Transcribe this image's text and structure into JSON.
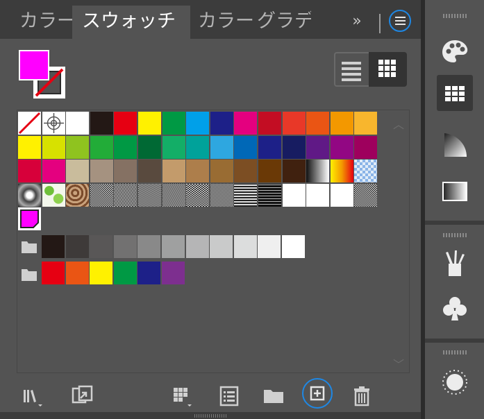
{
  "tabs": [
    {
      "label": "カラー"
    },
    {
      "label": "スウォッチ"
    },
    {
      "label": "カラー"
    },
    {
      "label": "グラデ"
    }
  ],
  "tab_overflow": "»",
  "colors": {
    "accent_ring": "#1e88e5",
    "fill_color": "#ff00ff",
    "panel_bg": "#535353",
    "tabbar_bg": "#3c3c3c"
  },
  "swatch_rows": {
    "row1": [
      "none",
      "registration",
      "#ffffff",
      "#231815",
      "#e60012",
      "#fff100",
      "#009944",
      "#00a0e9",
      "#1d2088",
      "#e4007f",
      "#c30d23",
      "#e83828",
      "#ea5514",
      "#f39800",
      "#f8b62d"
    ],
    "row2": [
      "#fff100",
      "#d7e100",
      "#8fc31f",
      "#22ac38",
      "#009944",
      "#006934",
      "#13ae67",
      "#00a29a",
      "#2ea7e0",
      "#0068b7",
      "#1d2088",
      "#171c61",
      "#601986",
      "#920783",
      "#9e005d"
    ],
    "row3": [
      "#d7003a",
      "#e4007f",
      "#c9bc9c",
      "#a59280",
      "#857163",
      "#594a3e",
      "#c39b6b",
      "#ad7e4b",
      "#996c33",
      "#7c4e23",
      "#6a3906",
      "#40210f",
      "gradient-bw",
      "gradient-ygr",
      "gradient-blue"
    ],
    "row4_patterns": [
      "pattern-radial",
      "pattern-leaf",
      "pattern-paisley",
      "pattern-noise1",
      "pattern-noise2",
      "pattern-noise3",
      "pattern-noise4",
      "pattern-noise5",
      "pattern-noise6",
      "pattern-lines",
      "pattern-lines2",
      "#ffffff",
      "#ffffff",
      "#ffffff",
      "pattern-noise7"
    ],
    "row5": [
      "selected-magenta"
    ],
    "group_gray": [
      "#231815",
      "#3e3a39",
      "#595757",
      "#727171",
      "#898989",
      "#9fa0a0",
      "#b5b5b6",
      "#c9caca",
      "#dcdddd",
      "#efefef",
      "#ffffff"
    ],
    "group_bright": [
      "#e60012",
      "#ea5514",
      "#fff100",
      "#009944",
      "#1d2088",
      "#7d2f8f"
    ]
  },
  "icons": {
    "menu": "menu-icon",
    "list_view": "list-view-icon",
    "grid_view": "grid-view-icon",
    "library": "library-icon",
    "place_swatch": "place-swatch-icon",
    "swatch_kind": "swatch-kind-icon",
    "options": "swatch-options-icon",
    "new_group": "new-group-folder-icon",
    "new_swatch": "new-swatch-icon",
    "delete": "trash-icon",
    "dock": [
      "palette-icon",
      "swatches-icon",
      "gradient-fan-icon",
      "gradient-icon",
      "brushes-icon",
      "symbols-icon",
      "brightness-icon"
    ]
  }
}
